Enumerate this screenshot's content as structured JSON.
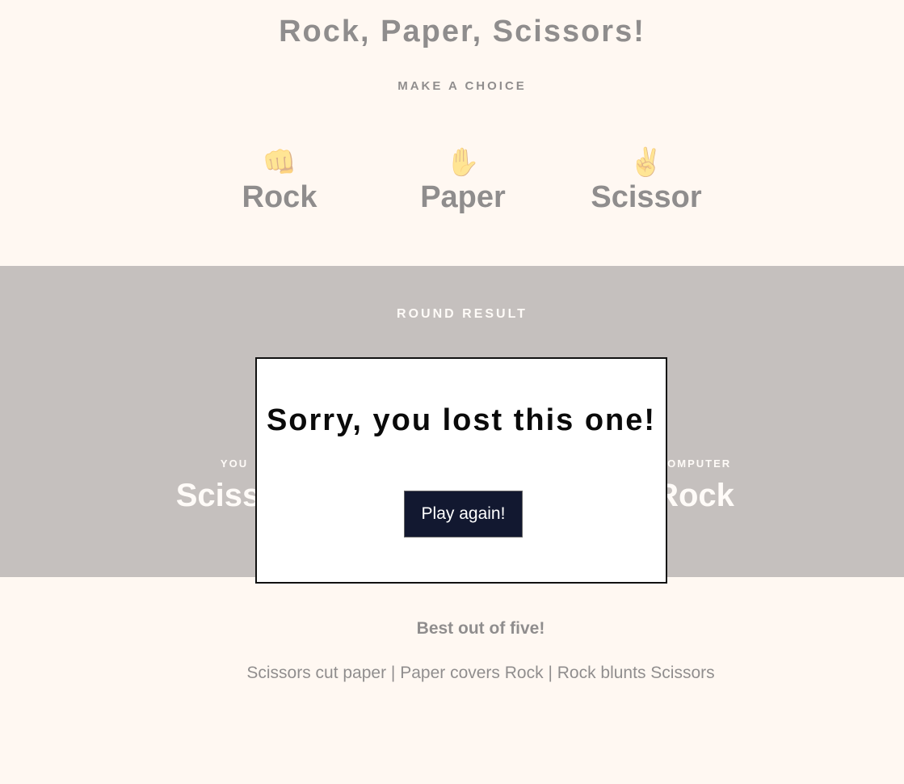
{
  "header": {
    "title": "Rock, Paper, Scissors!",
    "subtitle": "MAKE A CHOICE",
    "choices": [
      {
        "emoji": "👊",
        "label": "Rock"
      },
      {
        "emoji": "✋",
        "label": "Paper"
      },
      {
        "emoji": "✌️",
        "label": "Scissor"
      }
    ]
  },
  "result": {
    "heading": "ROUND RESULT",
    "you": {
      "label": "YOU",
      "choice": "Scissor"
    },
    "computer": {
      "label": "COMPUTER",
      "choice": "Rock"
    }
  },
  "footer": {
    "title": "Best out of five!",
    "rules": "Scissors cut paper | Paper covers Rock | Rock blunts Scissors"
  },
  "modal": {
    "message": "Sorry, you lost this one!",
    "button_label": "Play again!"
  }
}
